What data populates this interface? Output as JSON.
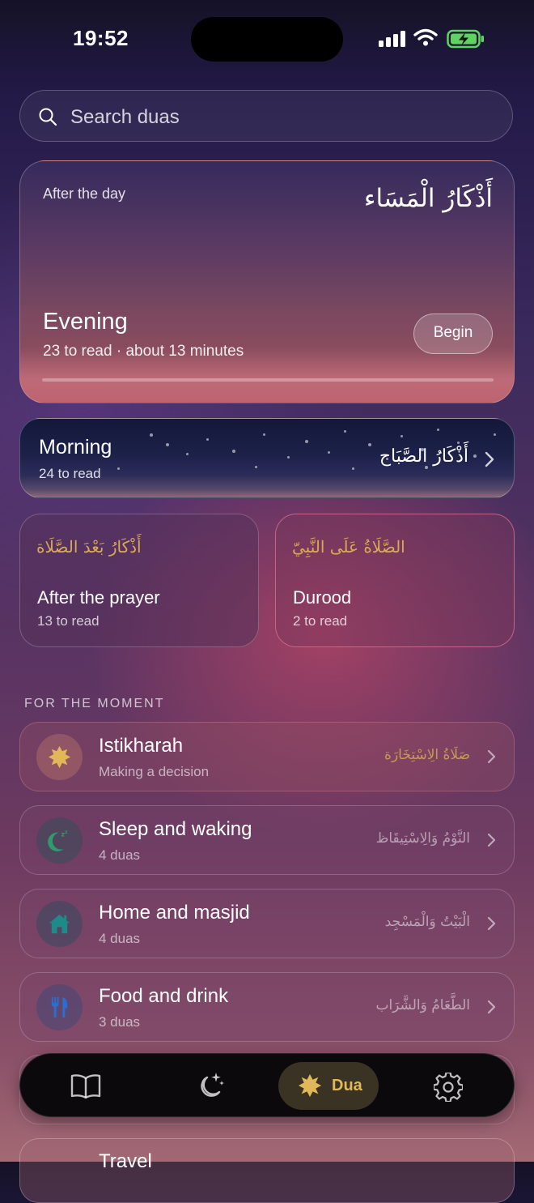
{
  "status_bar": {
    "time": "19:52"
  },
  "search": {
    "placeholder": "Search duas"
  },
  "hero": {
    "kicker": "After the day",
    "arabic": "أَذْكَارُ الْمَسَاء",
    "title": "Evening",
    "subtitle": "23 to read · about 13 minutes",
    "button_label": "Begin",
    "progress": 0.0
  },
  "morning": {
    "title": "Morning",
    "subtitle": "24 to read",
    "arabic": "أَذْكَارُ الصَّبَاح"
  },
  "tiles": [
    {
      "arabic": "أَذْكَارُ بَعْدَ الصَّلَاة",
      "title": "After the prayer",
      "subtitle": "13 to read"
    },
    {
      "arabic": "الصَّلَاةُ عَلَى النَّبِيّ",
      "title": "Durood",
      "subtitle": "2 to read"
    }
  ],
  "section_label": "FOR THE MOMENT",
  "moments": [
    {
      "title": "Istikharah",
      "subtitle": "Making a decision",
      "arabic": "صَلَاةُ الِاسْتِخَارَة",
      "icon": "star-icon",
      "icon_color": "#e0b85a"
    },
    {
      "title": "Sleep and waking",
      "subtitle": "4 duas",
      "arabic": "النَّوْمُ وَالِاسْتِيقَاظ",
      "icon": "moon-icon",
      "icon_color": "#2f9b6c"
    },
    {
      "title": "Home and masjid",
      "subtitle": "4 duas",
      "arabic": "الْبَيْتُ وَالْمَسْجِد",
      "icon": "home-icon",
      "icon_color": "#1f8a8a"
    },
    {
      "title": "Food and drink",
      "subtitle": "3 duas",
      "arabic": "الطَّعَامُ وَالشَّرَاب",
      "icon": "utensils-icon",
      "icon_color": "#2a6fd0"
    }
  ],
  "travel": {
    "title": "Travel"
  },
  "tabbar": {
    "tabs": [
      {
        "icon": "book-icon",
        "label": ""
      },
      {
        "icon": "moon-stars-icon",
        "label": ""
      },
      {
        "icon": "dua-star-icon",
        "label": "Dua"
      },
      {
        "icon": "gear-icon",
        "label": ""
      }
    ],
    "active": "Dua",
    "accent": "#e0b85a"
  }
}
